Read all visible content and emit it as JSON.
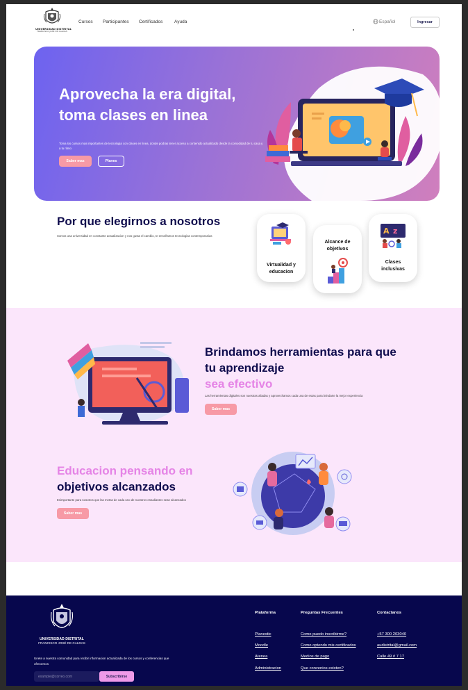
{
  "nav": {
    "logo": {
      "line1": "UNIVERSIDAD DISTRITAL",
      "line2": "FRANCISCO JOSÉ DE CALDAS"
    },
    "links": [
      "Cursos",
      "Participantes",
      "Certificados",
      "Ayuda"
    ],
    "language": "Español",
    "login_label": "Ingresar"
  },
  "hero": {
    "title_line1": "Aprovecha la era digital,",
    "title_line2": "toma clases en linea",
    "subtitle": "Toma los cursos mas importantes de tecnologia con clases en linea, donde podras tener acceso a contenido actualizado desde la comodidad de tu casa y a tu ritmo",
    "btn_primary": "Saber mas",
    "btn_secondary": "Planes"
  },
  "why": {
    "title": "Por que elegirnos a nosotros",
    "subtitle": "Somos una universidad en constante actualizacion y nos gusta el cambio, te enseñamos tecnologias contemporanias",
    "cards": [
      {
        "label_line1": "Virtualidad y",
        "label_line2": "educacion",
        "icon": "online-learning-icon"
      },
      {
        "label_line1": "Alcance de",
        "label_line2": "objetivos",
        "icon": "goal-target-icon"
      },
      {
        "label_line1": "Clases",
        "label_line2": "inclusivas",
        "icon": "inclusive-class-icon"
      }
    ]
  },
  "tools": {
    "title_line1": "Brindamos herramientas para que",
    "title_line2": "tu aprendizaje",
    "title_highlight": "sea efectivo",
    "subtitle": "Las herramientas digitales son nuestras aliadas y aprovechamos cada una de estas para brindarte la mejor experiencia",
    "button": "Saber mas"
  },
  "goals": {
    "title_highlight": "Educacion pensando en",
    "title_line2": "objetivos alcanzados",
    "subtitle": "Esimportante para nosotros que las metas de cada uno de nuestros estudiantes sean alcanzados",
    "button": "Saber mas"
  },
  "footer": {
    "logo": {
      "line1": "UNIVERSIDAD DISTRITAL",
      "line2": "FRANCISCO JOSÉ DE CALDAS"
    },
    "text": "Unete a nuestra comunidad para recibir informacion actualizada de los cursos y conferencias que ofrecemos",
    "email_placeholder": "example@correo.com",
    "subscribe_label": "Subscribirse",
    "columns": [
      {
        "heading": "Plataforma",
        "links": [
          "Planestic",
          "Moodle",
          "Atenea",
          "Administracion"
        ]
      },
      {
        "heading": "Preguntas Frecuentes",
        "links": [
          "Como puedo inscribirme?",
          "Como optendo mis certificados",
          "Medios de pago",
          "Que convenios existen?"
        ]
      },
      {
        "heading": "Contactanos",
        "links": [
          "+57 300 203040",
          "audistrital@gmail.com",
          "Calle 49 # 7 17"
        ]
      }
    ]
  },
  "colors": {
    "navy": "#0f0c4d",
    "pink_button": "#f79aa6",
    "highlight": "#e584e6",
    "section_bg": "#fbe6fb",
    "footer_bg": "#07074d"
  }
}
